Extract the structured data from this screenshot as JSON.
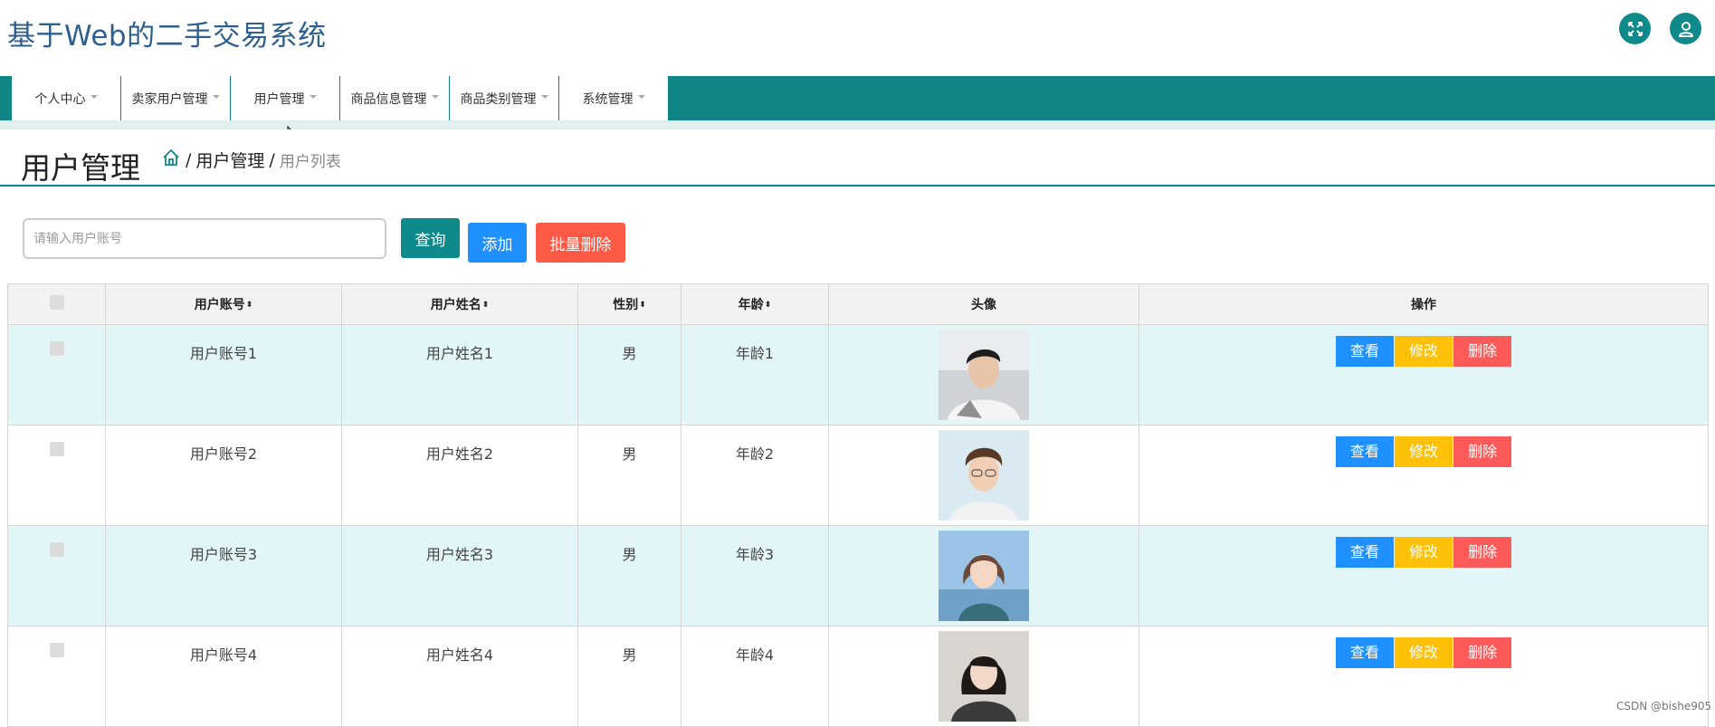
{
  "app": {
    "title": "基于Web的二手交易系统"
  },
  "top_icons": {
    "fullscreen": "fullscreen-icon",
    "user": "user-icon"
  },
  "nav": {
    "items": [
      {
        "label": "个人中心"
      },
      {
        "label": "卖家用户管理"
      },
      {
        "label": "用户管理"
      },
      {
        "label": "商品信息管理"
      },
      {
        "label": "商品类别管理"
      },
      {
        "label": "系统管理"
      }
    ]
  },
  "page": {
    "title": "用户管理",
    "breadcrumb": {
      "sep": "/",
      "section": "用户管理",
      "current": "用户列表"
    }
  },
  "search": {
    "placeholder": "请输入用户账号",
    "value": ""
  },
  "toolbar": {
    "search_label": "查询",
    "add_label": "添加",
    "bulk_delete_label": "批量删除"
  },
  "table": {
    "headers": {
      "account": "用户账号",
      "name": "用户姓名",
      "gender": "性别",
      "age": "年龄",
      "avatar": "头像",
      "ops": "操作"
    },
    "sort_glyph": "⬍",
    "rows": [
      {
        "account": "用户账号1",
        "name": "用户姓名1",
        "gender": "男",
        "age": "年龄1",
        "avatar": "avatar-photo"
      },
      {
        "account": "用户账号2",
        "name": "用户姓名2",
        "gender": "男",
        "age": "年龄2",
        "avatar": "avatar-photo"
      },
      {
        "account": "用户账号3",
        "name": "用户姓名3",
        "gender": "男",
        "age": "年龄3",
        "avatar": "avatar-photo"
      },
      {
        "account": "用户账号4",
        "name": "用户姓名4",
        "gender": "男",
        "age": "年龄4",
        "avatar": "avatar-photo"
      }
    ],
    "ops": {
      "view": "查看",
      "edit": "修改",
      "delete": "删除"
    }
  },
  "watermark": "CSDN @bishe905",
  "colors": {
    "primary": "#0f8585",
    "view": "#1e90ff",
    "edit": "#ffc107",
    "delete": "#ff5a5a",
    "bulk_delete": "#ff5a45",
    "row_stripe": "#e2f5f7"
  }
}
